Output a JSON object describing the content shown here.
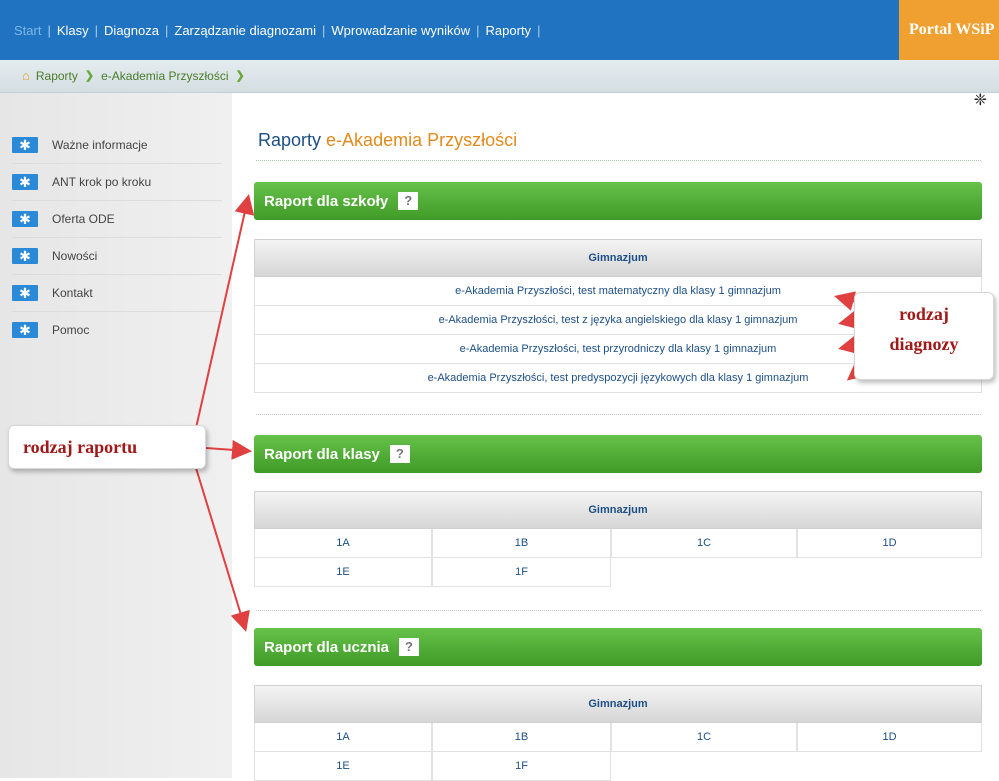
{
  "nav": {
    "items": [
      "Start",
      "Klasy",
      "Diagnoza",
      "Zarządzanie diagnozami",
      "Wprowadzanie wyników",
      "Raporty"
    ],
    "separator": "|",
    "portal": "Portal WSiP"
  },
  "breadcrumb": [
    "Raporty",
    "e-Akademia Przyszłości"
  ],
  "sidebar": {
    "items": [
      "Ważne informacje",
      "ANT krok po kroku",
      "Oferta ODE",
      "Nowości",
      "Kontakt",
      "Pomoc"
    ]
  },
  "page_title": {
    "part1": "Raporty",
    "part2": "e-Akademia Przyszłości"
  },
  "sections": {
    "school": {
      "title": "Raport dla szkoły",
      "help": "?",
      "table_header": "Gimnazjum",
      "rows": [
        "e-Akademia Przyszłości, test matematyczny dla klasy 1 gimnazjum",
        "e-Akademia Przyszłości, test z języka angielskiego dla klasy 1 gimnazjum",
        "e-Akademia Przyszłości, test przyrodniczy dla klasy 1 gimnazjum",
        "e-Akademia Przyszłości, test predyspozycji językowych dla klasy 1 gimnazjum"
      ]
    },
    "class": {
      "title": "Raport dla klasy",
      "help": "?",
      "table_header": "Gimnazjum",
      "classes": [
        "1A",
        "1B",
        "1C",
        "1D",
        "1E",
        "1F"
      ]
    },
    "student": {
      "title": "Raport dla ucznia",
      "help": "?",
      "table_header": "Gimnazjum",
      "classes": [
        "1A",
        "1B",
        "1C",
        "1D",
        "1E",
        "1F"
      ]
    }
  },
  "annotations": {
    "report_type": "rodzaj raportu",
    "diagnosis_type_line1": "rodzaj",
    "diagnosis_type_line2": "diagnozy"
  }
}
